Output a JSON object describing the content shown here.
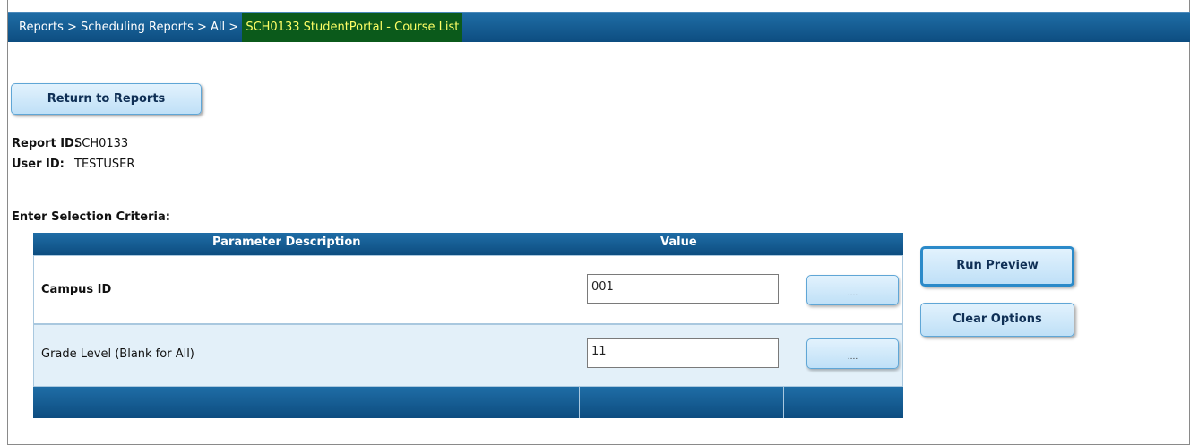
{
  "breadcrumb": {
    "path": "Reports > Scheduling Reports > All > ",
    "current": "SCH0133 StudentPortal - Course List"
  },
  "buttons": {
    "return_label": "Return to Reports",
    "run_preview_label": "Run Preview",
    "clear_options_label": "Clear Options",
    "lookup_label": "...."
  },
  "report_info": {
    "report_id_label": "Report ID:",
    "report_id_value": "SCH0133",
    "user_id_label": "User ID:",
    "user_id_value": "TESTUSER"
  },
  "criteria": {
    "title": "Enter Selection Criteria:",
    "columns": [
      "Parameter Description",
      "Value"
    ],
    "rows": [
      {
        "label": "Campus ID",
        "value": "001"
      },
      {
        "label": "Grade Level (Blank for All)",
        "value": "11"
      }
    ]
  },
  "colors": {
    "header_blue": "#0d4d80",
    "breadcrumb_highlight_bg": "#0b5a1b",
    "breadcrumb_highlight_text": "#ffff66",
    "button_fill": "#bfe0f7"
  }
}
